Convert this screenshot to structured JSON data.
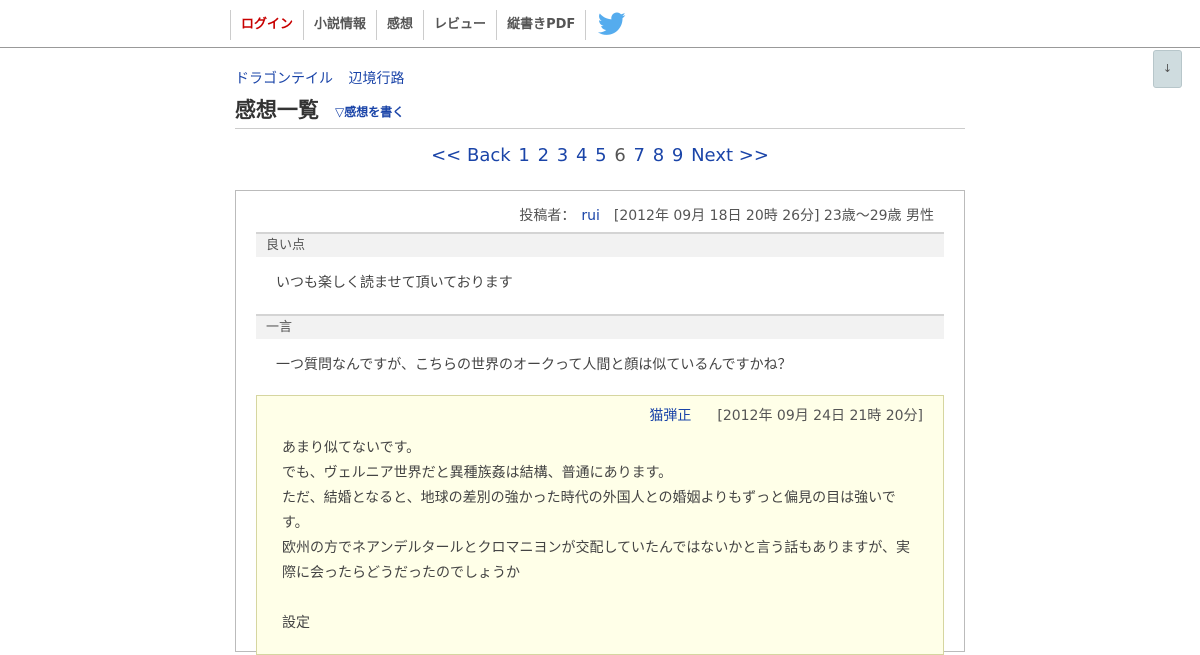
{
  "nav": {
    "items": [
      "ログイン",
      "小説情報",
      "感想",
      "レビュー",
      "縦書きPDF"
    ],
    "twitter_icon": "twitter-bird-icon",
    "twitter_color": "#55acee",
    "login_color": "#c80000"
  },
  "scroll_button": "↓",
  "breadcrumb": [
    "ドラゴンテイル",
    "辺境行路"
  ],
  "page_title": "感想一覧",
  "write_link": "▽感想を書く",
  "pager": {
    "back": "<< Back",
    "pages": [
      "1",
      "2",
      "3",
      "4",
      "5",
      "6",
      "7",
      "8",
      "9"
    ],
    "current": "6",
    "next": "Next >>"
  },
  "impression": {
    "poster_label": "投稿者：",
    "poster_name": "rui",
    "poster_info": "[2012年 09月 18日 20時 26分] 23歳～29歳 男性",
    "good_points_label": "良い点",
    "good_points_text": "いつも楽しく読ませて頂いております",
    "comment_label": "一言",
    "comment_text": "一つ質問なんですが、こちらの世界のオークって人間と顔は似ているんですかね？",
    "reply": {
      "author": "猫弾正",
      "date": "[2012年 09月 24日 21時 20分]",
      "body": "あまり似てないです。\nでも、ヴェルニア世界だと異種族姦は結構、普通にあります。\nただ、結婚となると、地球の差別の強かった時代の外国人との婚姻よりもずっと偏見の目は強いです。\n欧州の方でネアンデルタールとクロマニヨンが交配していたんではないかと言う話もありますが、実際に会ったらどうだったのでしょうか\n\n設定"
    }
  }
}
